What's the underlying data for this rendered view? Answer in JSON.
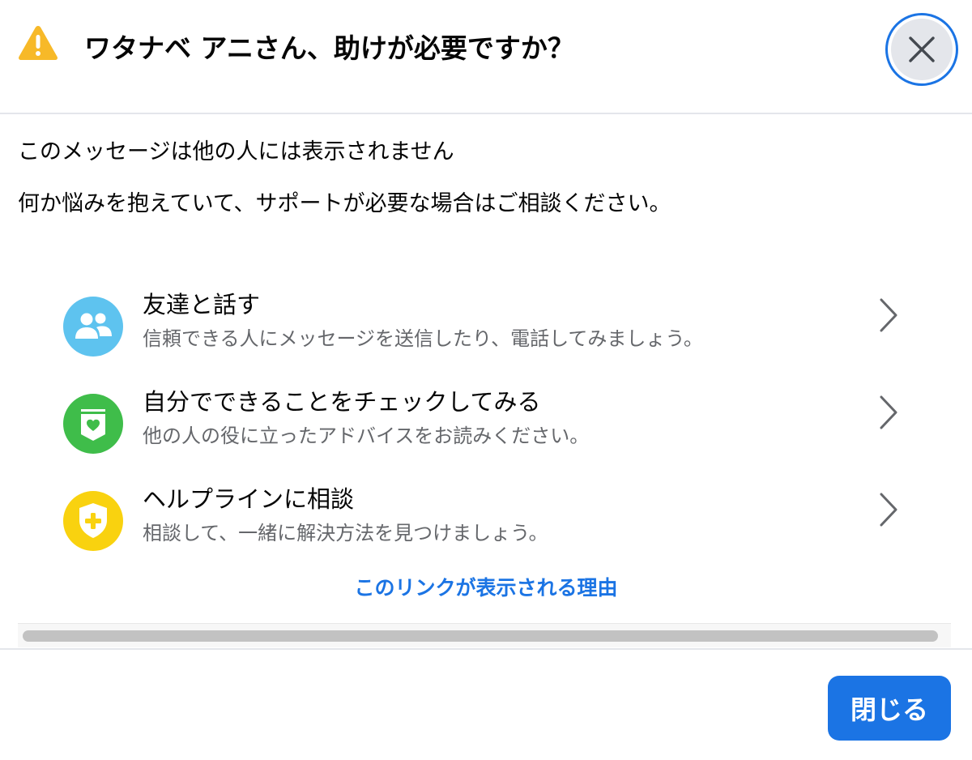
{
  "header": {
    "title": "ワタナベ アニさん、助けが必要ですか？",
    "warning_icon": "warning-triangle-icon",
    "close_icon": "close-icon"
  },
  "body": {
    "notice": "このメッセージは他の人には表示されません",
    "intro": "何か悩みを抱えていて、サポートが必要な場合はご相談ください。"
  },
  "options": [
    {
      "title": "友達と話す",
      "subtitle": "信頼できる人にメッセージを送信したり、電話してみましょう。",
      "icon": "friends-icon",
      "color": "#5ec3ef"
    },
    {
      "title": "自分でできることをチェックしてみる",
      "subtitle": "他の人の役に立ったアドバイスをお読みください。",
      "icon": "heart-bookmark-icon",
      "color": "#3fbd4a"
    },
    {
      "title": "ヘルプラインに相談",
      "subtitle": "相談して、一緒に解決方法を見つけましょう。",
      "icon": "shield-plus-icon",
      "color": "#f9d20f"
    }
  ],
  "link": {
    "why": "このリンクが表示される理由"
  },
  "footer": {
    "close_label": "閉じる"
  },
  "colors": {
    "accent": "#1b74e4",
    "warning": "#f7b928",
    "secondary_text": "#65676b"
  }
}
